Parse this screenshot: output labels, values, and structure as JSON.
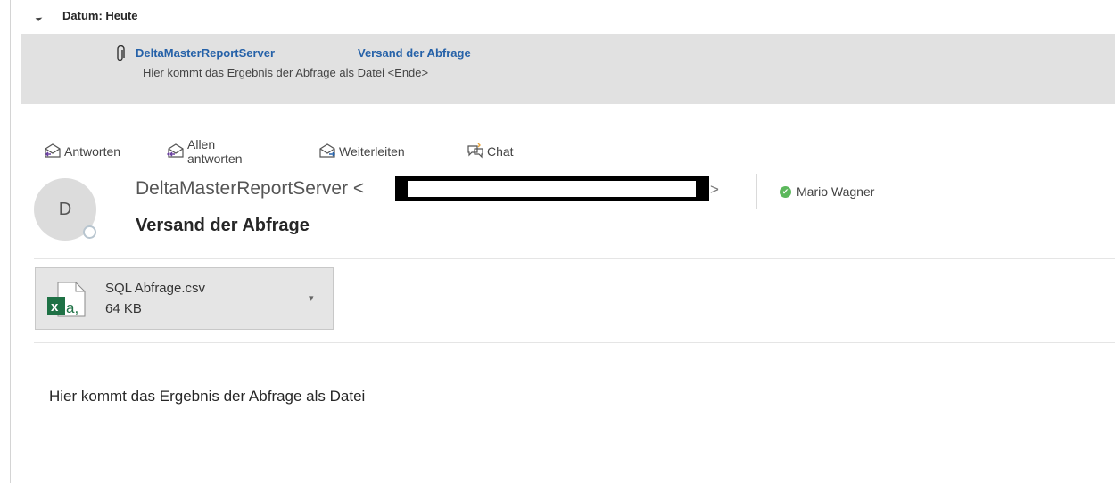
{
  "message_list": {
    "group_label": "Datum: Heute",
    "item": {
      "sender": "DeltaMasterReportServer",
      "subject": "Versand der Abfrage",
      "preview": "Hier kommt das Ergebnis der Abfrage als Datei <Ende>"
    }
  },
  "toolbar": {
    "reply_label": "Antworten",
    "reply_all_label": "Allen antworten",
    "forward_label": "Weiterleiten",
    "chat_label": "Chat"
  },
  "header": {
    "avatar_initial": "D",
    "from_name": "DeltaMasterReportServer <",
    "from_close": ">",
    "recipient": "Mario Wagner",
    "subject": "Versand der Abfrage"
  },
  "attachment": {
    "filename": "SQL Abfrage.csv",
    "size": "64 KB",
    "icon": "excel-csv-icon"
  },
  "body": {
    "text": "Hier kommt das Ergebnis der Abfrage als Datei"
  },
  "colors": {
    "link_blue": "#2561a8",
    "list_bg": "#e1e1e1",
    "presence_green": "#5cb85c",
    "excel_green": "#1e7145"
  }
}
